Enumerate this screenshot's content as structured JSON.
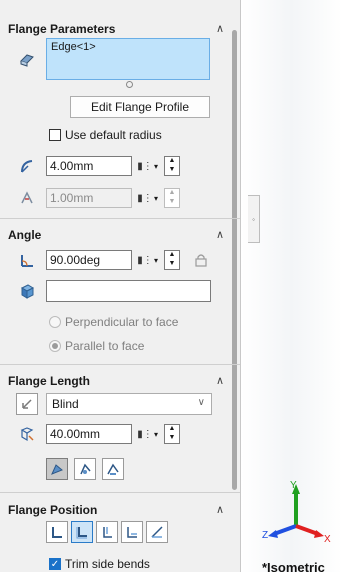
{
  "flange_parameters": {
    "title": "Flange Parameters",
    "edge_selection": "Edge<1>",
    "edit_profile_label": "Edit Flange Profile",
    "use_default_radius_label": "Use default radius",
    "use_default_radius_checked": false,
    "bend_radius": "4.00mm",
    "gap_distance": "1.00mm"
  },
  "angle": {
    "title": "Angle",
    "angle_value": "90.00deg",
    "reference_face_value": "",
    "perpendicular_label": "Perpendicular to face",
    "parallel_label": "Parallel to face",
    "selected_option": "parallel"
  },
  "flange_length": {
    "title": "Flange Length",
    "end_condition": "Blind",
    "length_value": "40.00mm"
  },
  "flange_position": {
    "title": "Flange Position",
    "trim_side_bends_label": "Trim side bends",
    "trim_side_bends_checked": true
  },
  "viewport": {
    "view_label": "*Isometric"
  },
  "colors": {
    "selection_box": "#bfe3fb",
    "axis_x": "#e02020",
    "axis_y": "#20a020",
    "axis_z": "#2050e0"
  }
}
